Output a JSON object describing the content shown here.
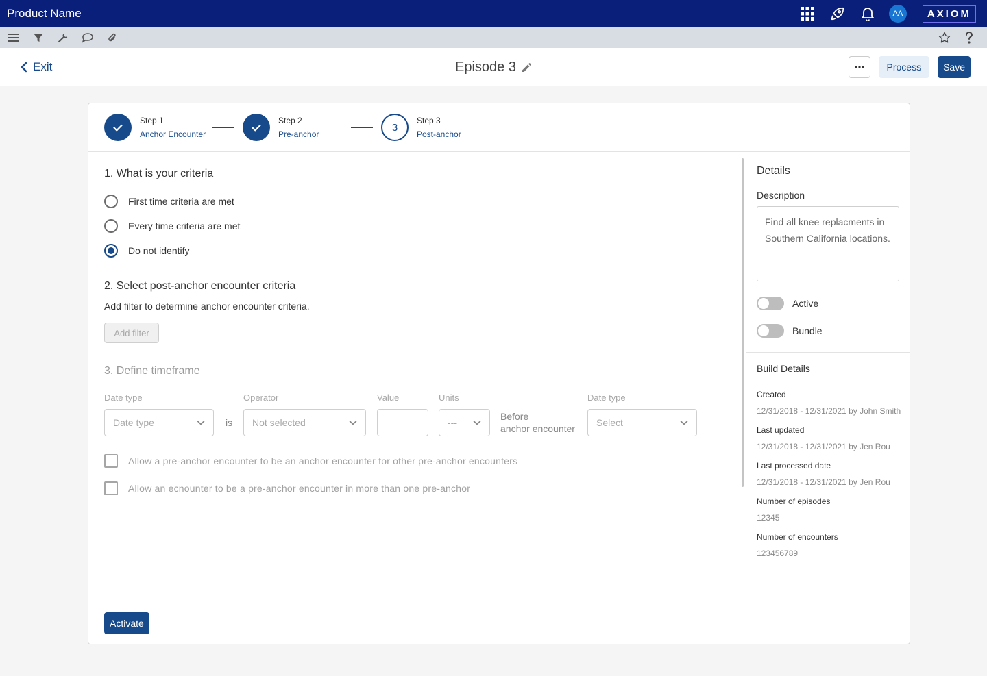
{
  "app": {
    "product_name": "Product Name",
    "brand": "AXIOM",
    "user_initials": "AA"
  },
  "header": {
    "exit_label": "Exit",
    "title": "Episode 3",
    "more_label": "•••",
    "process_label": "Process",
    "save_label": "Save"
  },
  "steps": [
    {
      "num": "Step 1",
      "label": "Anchor Encounter",
      "state": "done"
    },
    {
      "num": "Step 2",
      "label": "Pre-anchor",
      "state": "done"
    },
    {
      "num": "Step 3",
      "label": "Post-anchor",
      "state": "current",
      "indicator": "3"
    }
  ],
  "criteria": {
    "title": "1. What is your criteria",
    "options": [
      {
        "label": "First time criteria are met",
        "checked": false
      },
      {
        "label": "Every time criteria are met",
        "checked": false
      },
      {
        "label": "Do not identify",
        "checked": true
      }
    ]
  },
  "post_anchor": {
    "title": "2. Select post-anchor encounter criteria",
    "help": "Add filter to determine anchor encounter criteria.",
    "add_filter_label": "Add filter"
  },
  "timeframe": {
    "title": "3. Define timeframe",
    "date_type_label": "Date type",
    "date_type_value": "Date type",
    "is_label": "is",
    "operator_label": "Operator",
    "operator_value": "Not selected",
    "value_label": "Value",
    "units_label": "Units",
    "units_value": "---",
    "before_line1": "Before",
    "before_line2": "anchor encounter",
    "date_type2_label": "Date type",
    "date_type2_value": "Select",
    "checks": [
      "Allow a pre-anchor encounter to be an anchor encounter for other pre-anchor encounters",
      "Allow an ecnounter to be a pre-anchor encounter in more than one pre-anchor"
    ]
  },
  "footer": {
    "activate_label": "Activate"
  },
  "details": {
    "title": "Details",
    "description_label": "Description",
    "description": "Find all knee replacments in Southern California locations.",
    "toggles": [
      {
        "label": "Active",
        "on": false
      },
      {
        "label": "Bundle",
        "on": false
      }
    ]
  },
  "build_details": {
    "title": "Build Details",
    "items": [
      {
        "label": "Created",
        "value": "12/31/2018 - 12/31/2021 by John Smith"
      },
      {
        "label": "Last updated",
        "value": "12/31/2018 - 12/31/2021 by Jen Rou"
      },
      {
        "label": "Last processed date",
        "value": "12/31/2018 - 12/31/2021 by Jen Rou"
      },
      {
        "label": "Number of episodes",
        "value": "12345"
      },
      {
        "label": "Number of encounters",
        "value": "123456789"
      }
    ]
  },
  "colors": {
    "navy": "#0a1f7a",
    "primary": "#174a8b",
    "toolbar": "#d7dde3"
  }
}
